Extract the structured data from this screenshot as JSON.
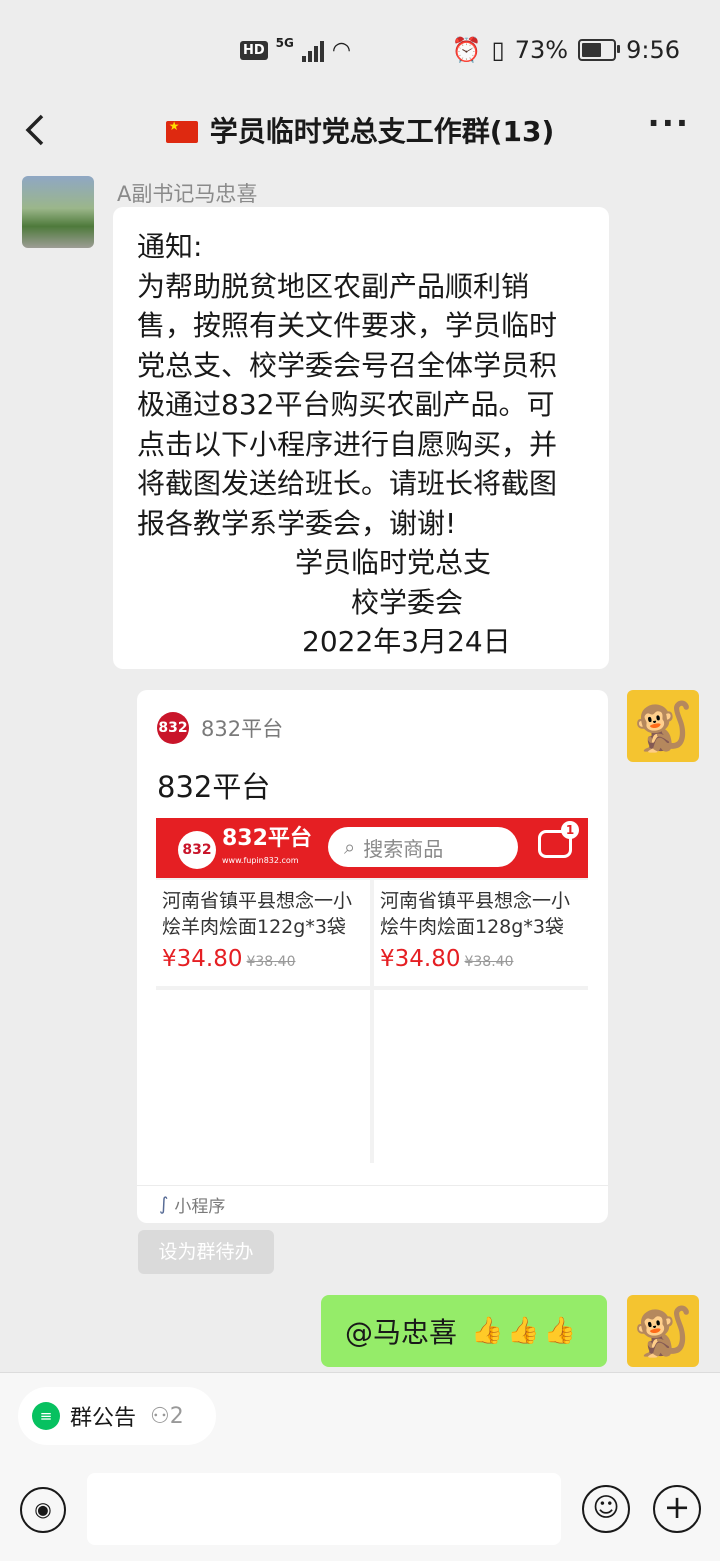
{
  "status_bar": {
    "hd": "HD",
    "network": "5G",
    "battery": "73%",
    "battery_level": 0.73,
    "time": "9:56"
  },
  "header": {
    "title": "学员临时党总支工作群(13)",
    "back_icon": "chevron-left-icon",
    "more_icon": "more-dots-icon"
  },
  "messages": {
    "first": {
      "sender": "A副书记马忠喜",
      "lines": [
        "通知:",
        "为帮助脱贫地区农副产品顺利销",
        "售，按照有关文件要求，学员临时",
        "党总支、校学委会号召全体学员积",
        "极通过832平台购买农副产品。可",
        "点击以下小程序进行自愿购买，并",
        "将截图发送给班长。请班长将截图",
        "报各教学系学委会，谢谢!"
      ],
      "signature": [
        "学员临时党总支",
        "校学委会",
        "2022年3月24日"
      ]
    },
    "mini_program": {
      "source": "832平台",
      "title": "832平台",
      "preview": {
        "brand": "832平台",
        "brand_sub": "www.fupin832.com",
        "search_placeholder": "搜索商品",
        "msg_badge": "1",
        "products": [
          {
            "name": "河南省镇平县想念一小烩羊肉烩面122g*3袋",
            "price": "¥34.80",
            "orig": "¥38.40"
          },
          {
            "name": "河南省镇平县想念一小烩牛肉烩面128g*3袋",
            "price": "¥34.80",
            "orig": "¥38.40"
          }
        ]
      },
      "footer": "小程序"
    },
    "todo_button": "设为群待办",
    "mine": {
      "text": "@马忠喜",
      "emoji": "👍👍👍"
    }
  },
  "bottom": {
    "notice_label": "群公告",
    "notice_count": "2",
    "input_value": ""
  },
  "colors": {
    "bubble_mine": "#95ec69",
    "brand_red": "#e51f23",
    "wechat_green": "#07c160"
  }
}
